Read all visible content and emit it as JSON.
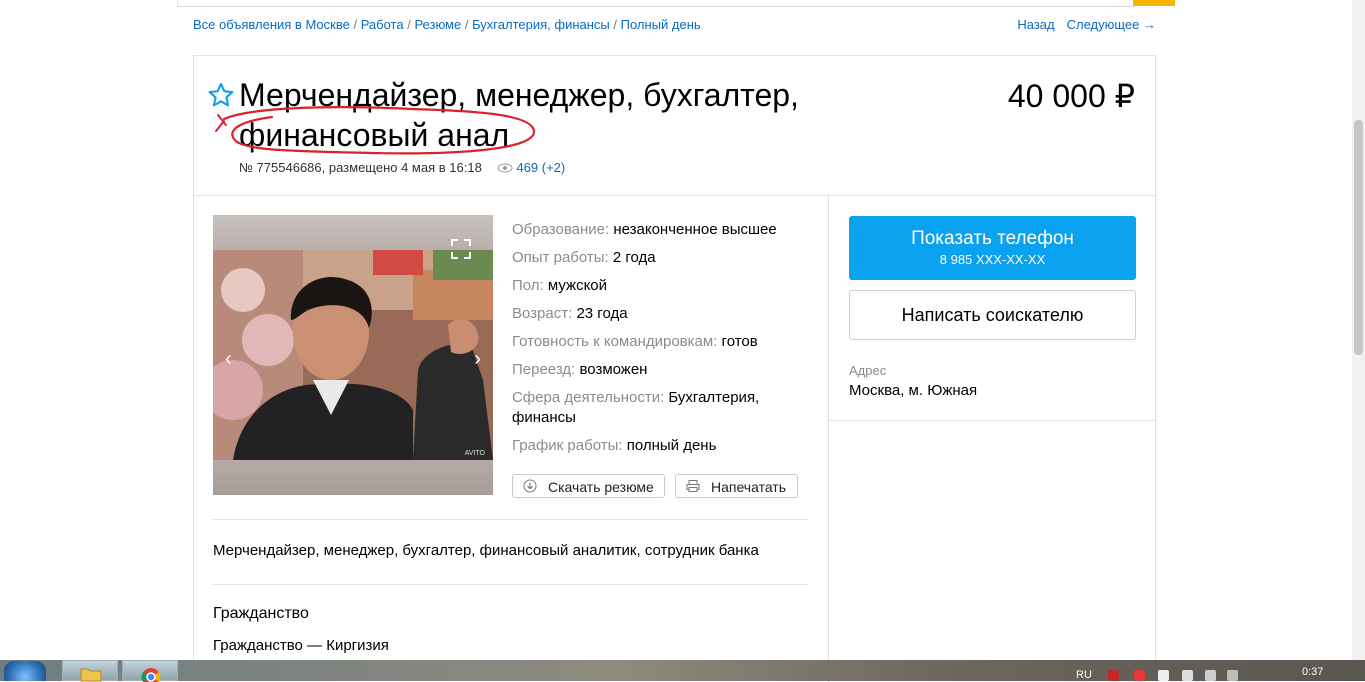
{
  "breadcrumbs": [
    "Все объявления в Москве",
    "Работа",
    "Резюме",
    "Бухгалтерия, финансы",
    "Полный день"
  ],
  "breadcrumb_separator": " / ",
  "nav": {
    "back": "Назад",
    "next": "Следующее →"
  },
  "listing": {
    "title": "Мерчендайзер, менеджер, бухгалтер, финансовый анал",
    "price": "40 000 ₽",
    "meta": "№ 775546686, размещено 4 мая в 16:18",
    "views": "469 (+2)"
  },
  "properties": [
    {
      "key": "Образование:",
      "value": "незаконченное высшее"
    },
    {
      "key": "Опыт работы:",
      "value": "2 года"
    },
    {
      "key": "Пол:",
      "value": "мужской"
    },
    {
      "key": "Возраст:",
      "value": "23 года"
    },
    {
      "key": "Готовность к командировкам:",
      "value": "готов"
    },
    {
      "key": "Переезд:",
      "value": "возможен"
    },
    {
      "key": "Сфера деятельности:",
      "value": "Бухгалтерия, финансы"
    },
    {
      "key": "График работы:",
      "value": "полный день"
    }
  ],
  "actions": {
    "download": "Скачать резюме",
    "print": "Напечатать"
  },
  "description": "Мерчендайзер, менеджер, бухгалтер, финансовый аналитик, сотрудник банка",
  "citizenship": {
    "title": "Гражданство",
    "text": "Гражданство — Киргизия"
  },
  "contact": {
    "show_phone": "Показать телефон",
    "phone_masked": "8 985 XXX-XX-XX",
    "write": "Написать соискателю",
    "address_label": "Адрес",
    "address": "Москва, м. Южная"
  },
  "taskbar": {
    "lang": "RU",
    "clock": "0:37"
  },
  "colors": {
    "link": "#0a6bbd",
    "accent": "#0aa1ef",
    "scribble": "#d9222a",
    "star": "#0aa1ef"
  }
}
